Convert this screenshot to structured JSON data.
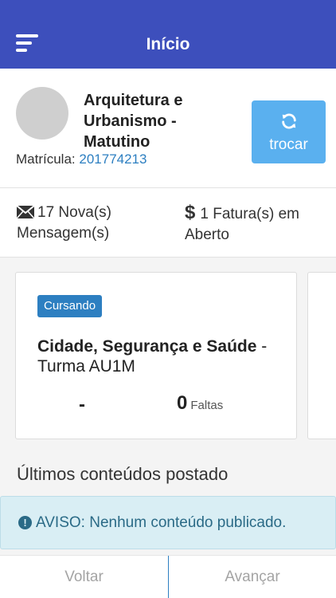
{
  "header": {
    "title": "Início"
  },
  "profile": {
    "course_name": "Arquitetura e Urbanismo - Matutino",
    "matricula_label": "Matrícula:",
    "matricula_number": "201774213",
    "switch_label": "trocar"
  },
  "stats": {
    "messages_count": "17",
    "messages_label": "Nova(s) Mensagem(s)",
    "invoices_count": "1",
    "invoices_label": "Fatura(s) em Aberto"
  },
  "card": {
    "status_badge": "Cursando",
    "subject": "Cidade, Segurança e Saúde",
    "class_text": "- Turma AU1M",
    "grade": "-",
    "absences": "0",
    "absences_label": "Faltas"
  },
  "section": {
    "title": "Últimos conteúdos postado"
  },
  "alert": {
    "text": "AVISO: Nenhum conteúdo publicado."
  },
  "footer": {
    "back_label": "Voltar",
    "next_label": "Avançar"
  },
  "colors": {
    "header": "#3d4fbc",
    "accent": "#2d7fc1",
    "switch_button": "#5ab0ef",
    "alert_bg": "#d9eef4"
  }
}
